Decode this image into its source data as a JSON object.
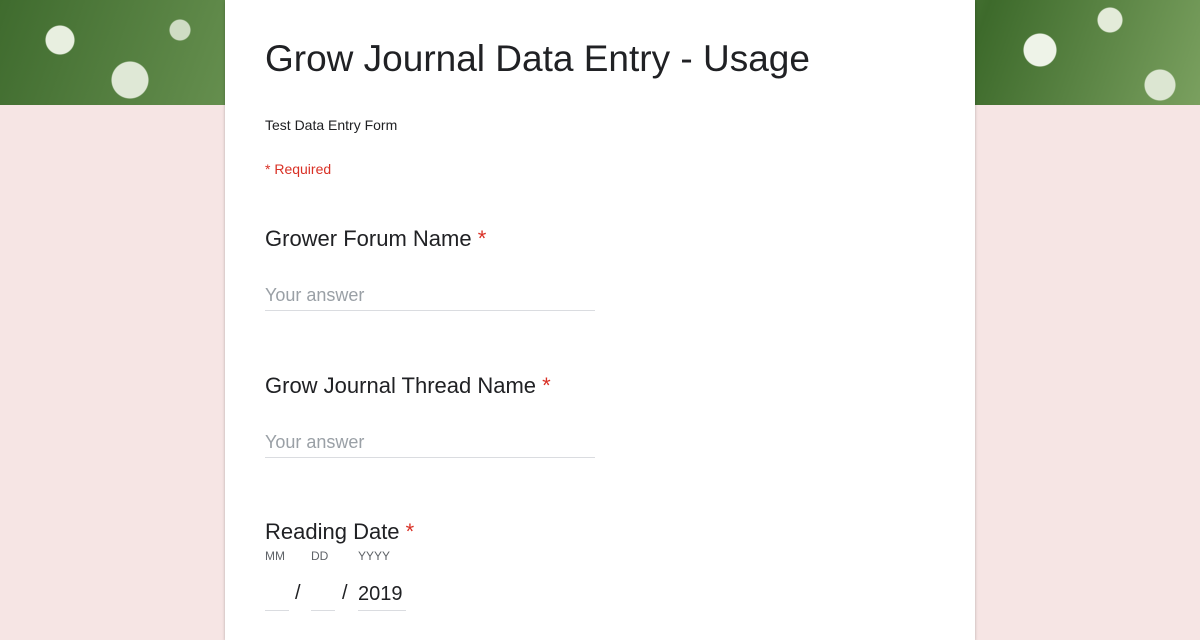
{
  "colors": {
    "page_background": "#f6e5e4",
    "card_background": "#ffffff",
    "required_accent": "#d93025"
  },
  "banner": {
    "icon": "flower-photo-banner"
  },
  "form": {
    "title": "Grow Journal Data Entry - Usage",
    "description": "Test Data Entry Form",
    "required_note": "* Required"
  },
  "questions": [
    {
      "label": "Grower Forum Name",
      "required_mark": "*",
      "placeholder": "Your answer",
      "value": ""
    },
    {
      "label": "Grow Journal Thread Name",
      "required_mark": "*",
      "placeholder": "Your answer",
      "value": ""
    }
  ],
  "date_question": {
    "label": "Reading Date",
    "required_mark": "*",
    "month_label": "MM",
    "day_label": "DD",
    "year_label": "YYYY",
    "month_value": "",
    "day_value": "",
    "year_value": "2019",
    "separator": "/"
  }
}
